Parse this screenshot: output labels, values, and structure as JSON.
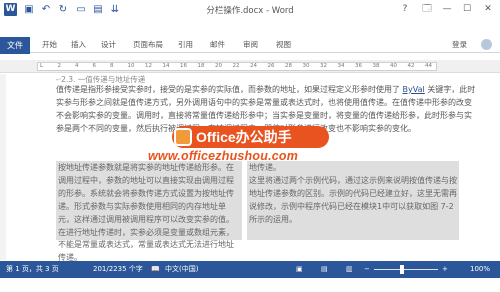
{
  "titlebar": {
    "app_icon": "W",
    "quick_access": [
      {
        "name": "save-icon",
        "glyph": "▣"
      },
      {
        "name": "undo-icon",
        "glyph": "↶"
      },
      {
        "name": "redo-icon",
        "glyph": "↻"
      },
      {
        "name": "new-document-icon",
        "glyph": "▭"
      },
      {
        "name": "layout-icon",
        "glyph": "▤"
      },
      {
        "name": "customize-icon",
        "glyph": "⇊"
      }
    ],
    "title": "分栏操作.docx - Word",
    "help": "?",
    "ribbon_display": "🗔",
    "minimize": "—",
    "maximize": "☐",
    "close": "✕"
  },
  "ribbon": {
    "file": "文件",
    "tabs": [
      "开始",
      "插入",
      "设计",
      "页面布局",
      "引用",
      "邮件",
      "审阅",
      "视图"
    ],
    "user": "登录"
  },
  "ruler": {
    "numbers": [
      "L",
      "2",
      "4",
      "6",
      "8",
      "10",
      "12",
      "14",
      "16",
      "18",
      "20",
      "22",
      "24",
      "26",
      "28",
      "30",
      "32",
      "34",
      "36",
      "38",
      "40",
      "42",
      "44"
    ]
  },
  "document": {
    "heading_fragment": "-·2.3. 一值传递与地址传递",
    "para1_start": "值传递是指形参接受实参时，接受的是实参的实际值，而",
    "para1_cont": "参数的地址，如果过程定义形参时使用了 ",
    "byval": "ByVal",
    "para1_rest": " 关键字，此时实参与形参之间就是值传递方式，另外调用语句中的实参是常量或表达式时，也将使用值传递。在值传递中形参的改变不会影响实参的变量。调用时，直接将常量值传递给形参中；当实参是变量时，将变量的值传递给形参，此时形参与实参是两个不同的变量，然后执行被调过程。在被调过程中，即使对形参进行改变也不影响实参的变化。",
    "col_left": "按地址传递参数就是将实参的地址传递给形参。在调用过程中，参数的地址可以直接实现由调用过程的形参。系统就会将参数传递方式设置为按地址传递。形式参数与实际参数使用相同的内存地址单元，这样通过调用被调用程序可以改变实参的值。在进行地址传递时，实参必须是变量或数组元素，不能是常量或表达式，常量或表达式无法进行地址传递。",
    "col_right": "地传递。\n这里将通过两个示例代码，通过这示例来说明按值传递与按地址传递参数的区别。示例的代码已经建立好，这里无需再说修改，示例中程序代码已经在模块1中可以获取如图 7-2 所示的运用。"
  },
  "watermark": {
    "badge": "Office办公助手",
    "url": "www.officezhushou.com"
  },
  "statusbar": {
    "page": "第 1 页，共 3 页",
    "words": "201/2235 个字",
    "proofing_icon": "📖",
    "language": "中文(中国)",
    "view_print": "▣",
    "view_read": "▤",
    "view_web": "▥",
    "zoom_minus": "−",
    "zoom_plus": "+",
    "zoom": "100%",
    "zoom_level_percent": 100
  }
}
